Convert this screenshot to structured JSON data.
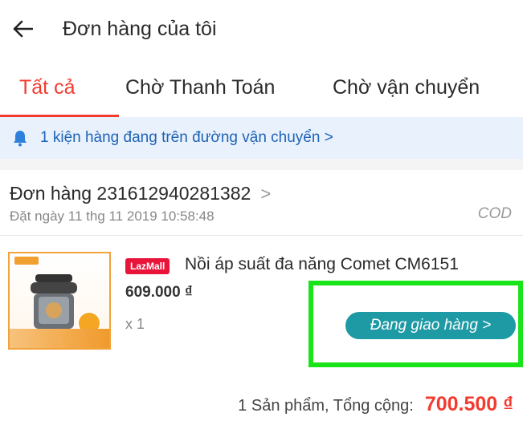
{
  "header": {
    "title": "Đơn hàng của tôi",
    "back_icon": "arrow-left-icon"
  },
  "tabs": [
    {
      "label": "Tất cả",
      "active": true
    },
    {
      "label": "Chờ Thanh Toán",
      "active": false
    },
    {
      "label": "Chờ vận chuyển",
      "active": false
    }
  ],
  "notice": {
    "icon": "bell-icon",
    "text": "1 kiện hàng đang trên đường vận chuyển >"
  },
  "order": {
    "id_text": "Đơn hàng 231612940281382",
    "chevron": ">",
    "date_text": "Đặt ngày 11 thg 11 2019  10:58:48",
    "payment": "COD"
  },
  "product": {
    "badge": "LazMall",
    "name": "Nồi áp suất đa năng Comet CM6151",
    "price": "609.000 ₫",
    "quantity": "x 1",
    "status_button": "Đang giao hàng >"
  },
  "summary": {
    "label": "1 Sản phẩm, Tổng cộng:",
    "total": "700.500 ₫"
  },
  "colors": {
    "accent": "#f23b2f",
    "status": "#1e9aa5",
    "notice_bg": "#e8f1fc",
    "notice_text": "#1e63b8",
    "highlight": "#19e319"
  }
}
